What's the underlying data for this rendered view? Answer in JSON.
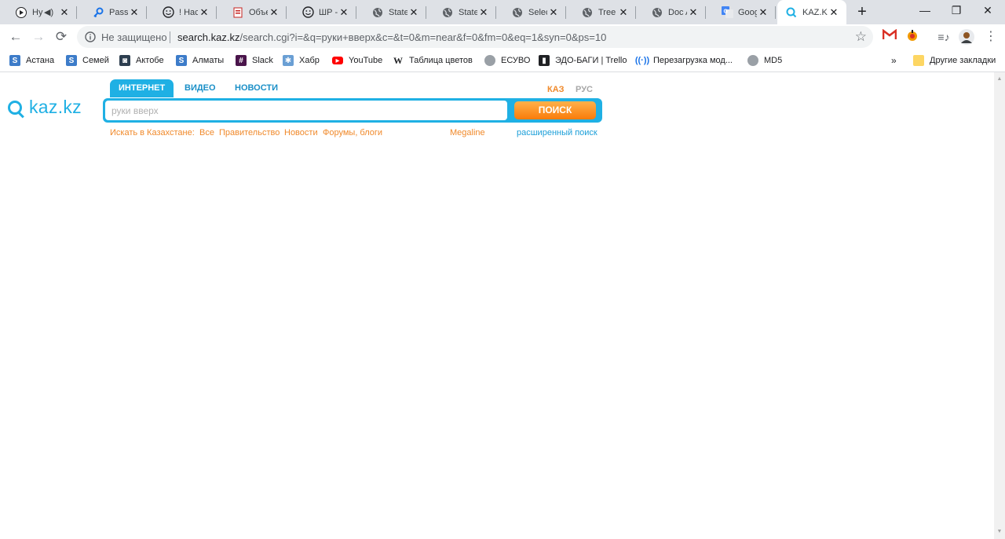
{
  "tabs": [
    {
      "title": "Hy",
      "icon": "play-icon",
      "audio": true
    },
    {
      "title": "Passwo",
      "icon": "key-icon"
    },
    {
      "title": "! Настр",
      "icon": "smiley-icon"
    },
    {
      "title": "Объек",
      "icon": "document-icon"
    },
    {
      "title": "ШР - е",
      "icon": "smiley-icon"
    },
    {
      "title": "State S",
      "icon": "globe-icon"
    },
    {
      "title": "State_",
      "icon": "globe-icon"
    },
    {
      "title": "Select",
      "icon": "globe-icon"
    },
    {
      "title": "Tree –",
      "icon": "globe-icon"
    },
    {
      "title": "Doc Ap",
      "icon": "globe-icon"
    },
    {
      "title": "Googl",
      "icon": "google-translate-icon"
    },
    {
      "title": "KAZ.K",
      "icon": "kazkz-icon",
      "active": true
    }
  ],
  "address_bar": {
    "security_label": "Не защищено",
    "url_host": "search.kaz.kz",
    "url_path": "/search.cgi?i=&q=руки+вверх&c=&t=0&m=near&f=0&fm=0&eq=1&syn=0&ps=10"
  },
  "bookmarks": [
    {
      "label": "Астана",
      "icon": "skype-icon"
    },
    {
      "label": "Семей",
      "icon": "skype-icon"
    },
    {
      "label": "Актобе",
      "icon": "app-icon"
    },
    {
      "label": "Алматы",
      "icon": "skype-icon"
    },
    {
      "label": "Slack",
      "icon": "slack-icon"
    },
    {
      "label": "Хабр",
      "icon": "habr-icon"
    },
    {
      "label": "YouTube",
      "icon": "youtube-icon"
    },
    {
      "label": "Таблица цветов",
      "icon": "wikipedia-icon"
    },
    {
      "label": "ЕСУВО",
      "icon": "globe-icon"
    },
    {
      "label": "ЭДО-БАГИ | Trello",
      "icon": "trello-icon"
    },
    {
      "label": "Перезагрузка мод...",
      "icon": "signal-icon"
    },
    {
      "label": "MD5",
      "icon": "globe-icon"
    }
  ],
  "bookmarks_more": "»",
  "other_bookmarks": "Другие закладки",
  "site": {
    "logo_text": "kaz.kz",
    "search_tabs": [
      "ИНТЕРНЕТ",
      "ВИДЕО",
      "НОВОСТИ"
    ],
    "lang_kaz": "КАЗ",
    "lang_rus": "РУС",
    "search_placeholder": "руки вверх",
    "search_button": "ПОИСК",
    "search_in_label": "Искать в Казахстане:",
    "scope_links": [
      "Все",
      "Правительство",
      "Новости",
      "Форумы, блоги"
    ],
    "megaline": "Megaline",
    "advanced": "расширенный поиск"
  },
  "colors": {
    "brand_blue": "#1fb0e4",
    "brand_orange": "#f0892a",
    "tabstrip": "#dee1e6"
  }
}
